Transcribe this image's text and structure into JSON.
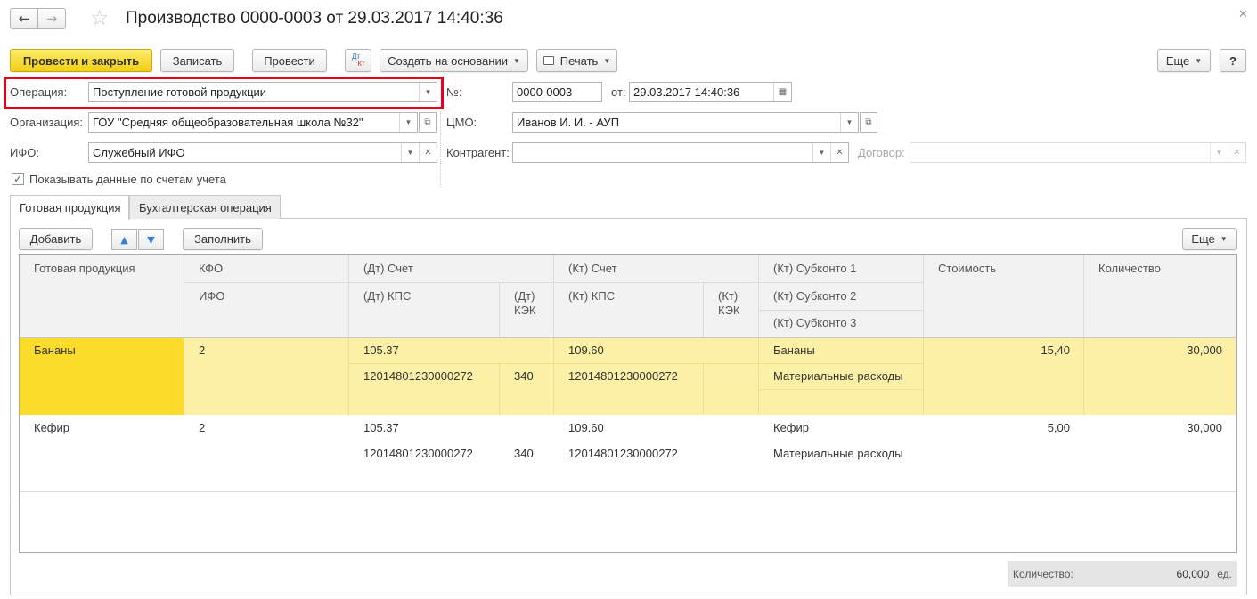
{
  "window": {
    "title": "Производство 0000-0003 от 29.03.2017 14:40:36"
  },
  "toolbar": {
    "post_close": "Провести и закрыть",
    "save": "Записать",
    "post": "Провести",
    "dt_kt_top": "Дт",
    "dt_kt_bottom": "Кт",
    "create_based": "Создать на основании",
    "print": "Печать",
    "more": "Еще",
    "help": "?"
  },
  "form": {
    "operation_label": "Операция:",
    "operation_value": "Поступление готовой продукции",
    "number_label": "№:",
    "number_value": "0000-0003",
    "date_label": "от:",
    "date_value": "29.03.2017 14:40:36",
    "org_label": "Организация:",
    "org_value": "ГОУ \"Средняя общеобразовательная школа №32\"",
    "cmo_label": "ЦМО:",
    "cmo_value": "Иванов И. И. - АУП",
    "ifo_label": "ИФО:",
    "ifo_value": "Служебный ИФО",
    "counterparty_label": "Контрагент:",
    "counterparty_value": "",
    "contract_label": "Договор:",
    "contract_value": "",
    "show_accounts_label": "Показывать данные по счетам учета",
    "show_accounts_checked": true
  },
  "tabs": [
    {
      "label": "Готовая продукция",
      "active": true
    },
    {
      "label": "Бухгалтерская операция",
      "active": false
    }
  ],
  "table_toolbar": {
    "add": "Добавить",
    "fill": "Заполнить",
    "more": "Еще"
  },
  "table": {
    "headers": {
      "product": "Готовая продукция",
      "kfo": "КФО",
      "ifo": "ИФО",
      "dt_account": "(Дт) Счет",
      "dt_kps": "(Дт) КПС",
      "dt_kek_1": "(Дт)",
      "dt_kek_2": "КЭК",
      "kt_account": "(Кт) Счет",
      "kt_kps": "(Кт) КПС",
      "kt_kek_1": "(Кт)",
      "kt_kek_2": "КЭК",
      "kt_sub1": "(Кт) Субконто 1",
      "kt_sub2": "(Кт) Субконто 2",
      "kt_sub3": "(Кт) Субконто 3",
      "cost": "Стоимость",
      "qty": "Количество"
    },
    "rows": [
      {
        "product": "Бананы",
        "kfo": "2",
        "dt_account": "105.37",
        "dt_kps": "12014801230000272",
        "dt_kek": "340",
        "kt_account": "109.60",
        "kt_kps": "12014801230000272",
        "kt_sub1": "Бананы",
        "kt_sub2": "Материальные расходы",
        "cost": "15,40",
        "qty": "30,000",
        "selected": true
      },
      {
        "product": "Кефир",
        "kfo": "2",
        "dt_account": "105.37",
        "dt_kps": "12014801230000272",
        "dt_kek": "340",
        "kt_account": "109.60",
        "kt_kps": "12014801230000272",
        "kt_sub1": "Кефир",
        "kt_sub2": "Материальные расходы",
        "cost": "5,00",
        "qty": "30,000",
        "selected": false
      }
    ]
  },
  "footer": {
    "qty_label": "Количество:",
    "qty_value": "60,000",
    "qty_unit": "ед."
  },
  "colors": {
    "primary_button": "#f2cf13",
    "selected_row": "#fbf0a6",
    "selected_cell": "#fcdc2a",
    "highlight_frame": "#e8001c"
  }
}
